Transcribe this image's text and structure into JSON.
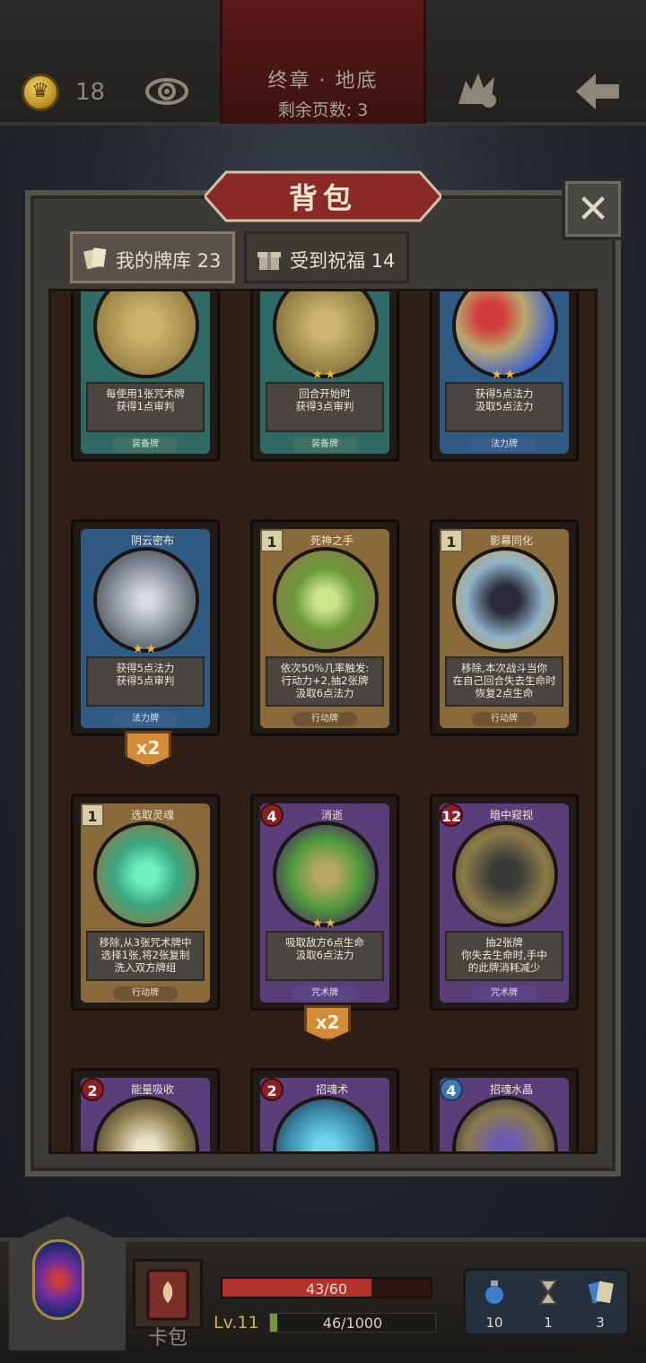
{
  "topbar": {
    "coins": "18",
    "chapter_title": "终章 · 地底",
    "pages_left": "剩余页数: 3"
  },
  "panel": {
    "title": "背包",
    "tabs": [
      {
        "label": "我的牌库 23",
        "active": true
      },
      {
        "label": "受到祝福 14",
        "active": false
      }
    ]
  },
  "cards": [
    {
      "name": "",
      "cost": "",
      "stars": "",
      "desc": "每使用1张咒术牌\n获得1点审判",
      "type": "装备牌"
    },
    {
      "name": "",
      "cost": "",
      "stars": "★★",
      "desc": "回合开始时\n获得3点审判",
      "type": "装备牌"
    },
    {
      "name": "",
      "cost": "",
      "stars": "★★",
      "desc": "获得5点法力\n汲取5点法力",
      "type": "法力牌"
    },
    {
      "name": "阴云密布",
      "cost": "",
      "stars": "★★",
      "desc": "获得5点法力\n获得5点审判",
      "type": "法力牌",
      "multi": "x2"
    },
    {
      "name": "死神之手",
      "cost": "1",
      "stars": "",
      "desc": "依次50%几率触发:\n行动力+2,抽2张牌\n汲取6点法力",
      "type": "行动牌"
    },
    {
      "name": "影幕同化",
      "cost": "1",
      "stars": "",
      "desc": "移除,本次战斗当你\n在自己回合失去生命时\n恢复2点生命",
      "type": "行动牌"
    },
    {
      "name": "选取灵魂",
      "cost": "1",
      "stars": "",
      "desc": "移除,从3张咒术牌中\n选择1张,将2张复制\n洗入双方牌组",
      "type": "行动牌"
    },
    {
      "name": "消逝",
      "cost": "4",
      "stars": "★★",
      "desc": "吸取敌方6点生命\n汲取6点法力",
      "type": "咒术牌",
      "multi": "x2"
    },
    {
      "name": "暗中窥视",
      "cost": "12",
      "stars": "",
      "desc": "抽2张牌\n你失去生命时,手中\n的此牌消耗减少",
      "type": "咒术牌"
    },
    {
      "name": "能量吸收",
      "cost": "2",
      "stars": "",
      "desc": "",
      "type": ""
    },
    {
      "name": "招魂术",
      "cost": "2",
      "stars": "",
      "desc": "",
      "type": ""
    },
    {
      "name": "招魂水晶",
      "cost": "4",
      "stars": "",
      "desc": "",
      "type": ""
    }
  ],
  "hud": {
    "cardpack_label": "卡包",
    "hp_text": "43/60",
    "hp_fraction": 0.717,
    "level": "Lv.11",
    "xp_text": "46/1000",
    "xp_fraction": 0.046,
    "res_potion": "10",
    "res_hourglass": "1",
    "res_cards": "3"
  }
}
